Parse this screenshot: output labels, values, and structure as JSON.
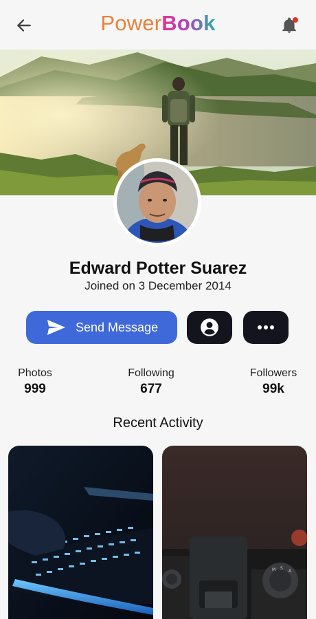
{
  "app": {
    "brand_part1": "Power",
    "brand_part2": "Book"
  },
  "icons": {
    "back": "arrow-left-icon",
    "notifications": "bell-icon",
    "send": "paper-plane-icon",
    "profile": "account-circle-icon",
    "more": "more-horizontal-icon"
  },
  "profile": {
    "name": "Edward Potter Suarez",
    "joined": "Joined on 3 December 2014"
  },
  "actions": {
    "send_message_label": "Send Message"
  },
  "stats": [
    {
      "label": "Photos",
      "value": "999"
    },
    {
      "label": "Following",
      "value": "677"
    },
    {
      "label": "Followers",
      "value": "99k"
    }
  ],
  "recent": {
    "title": "Recent Activity",
    "items": [
      {
        "subject": "backlit keyboard"
      },
      {
        "subject": "camera"
      }
    ]
  },
  "colors": {
    "accent_blue": "#3f68d9",
    "dark_button": "#14141f",
    "notification_dot": "#e0332b",
    "brand_orange": "#e8823a"
  }
}
